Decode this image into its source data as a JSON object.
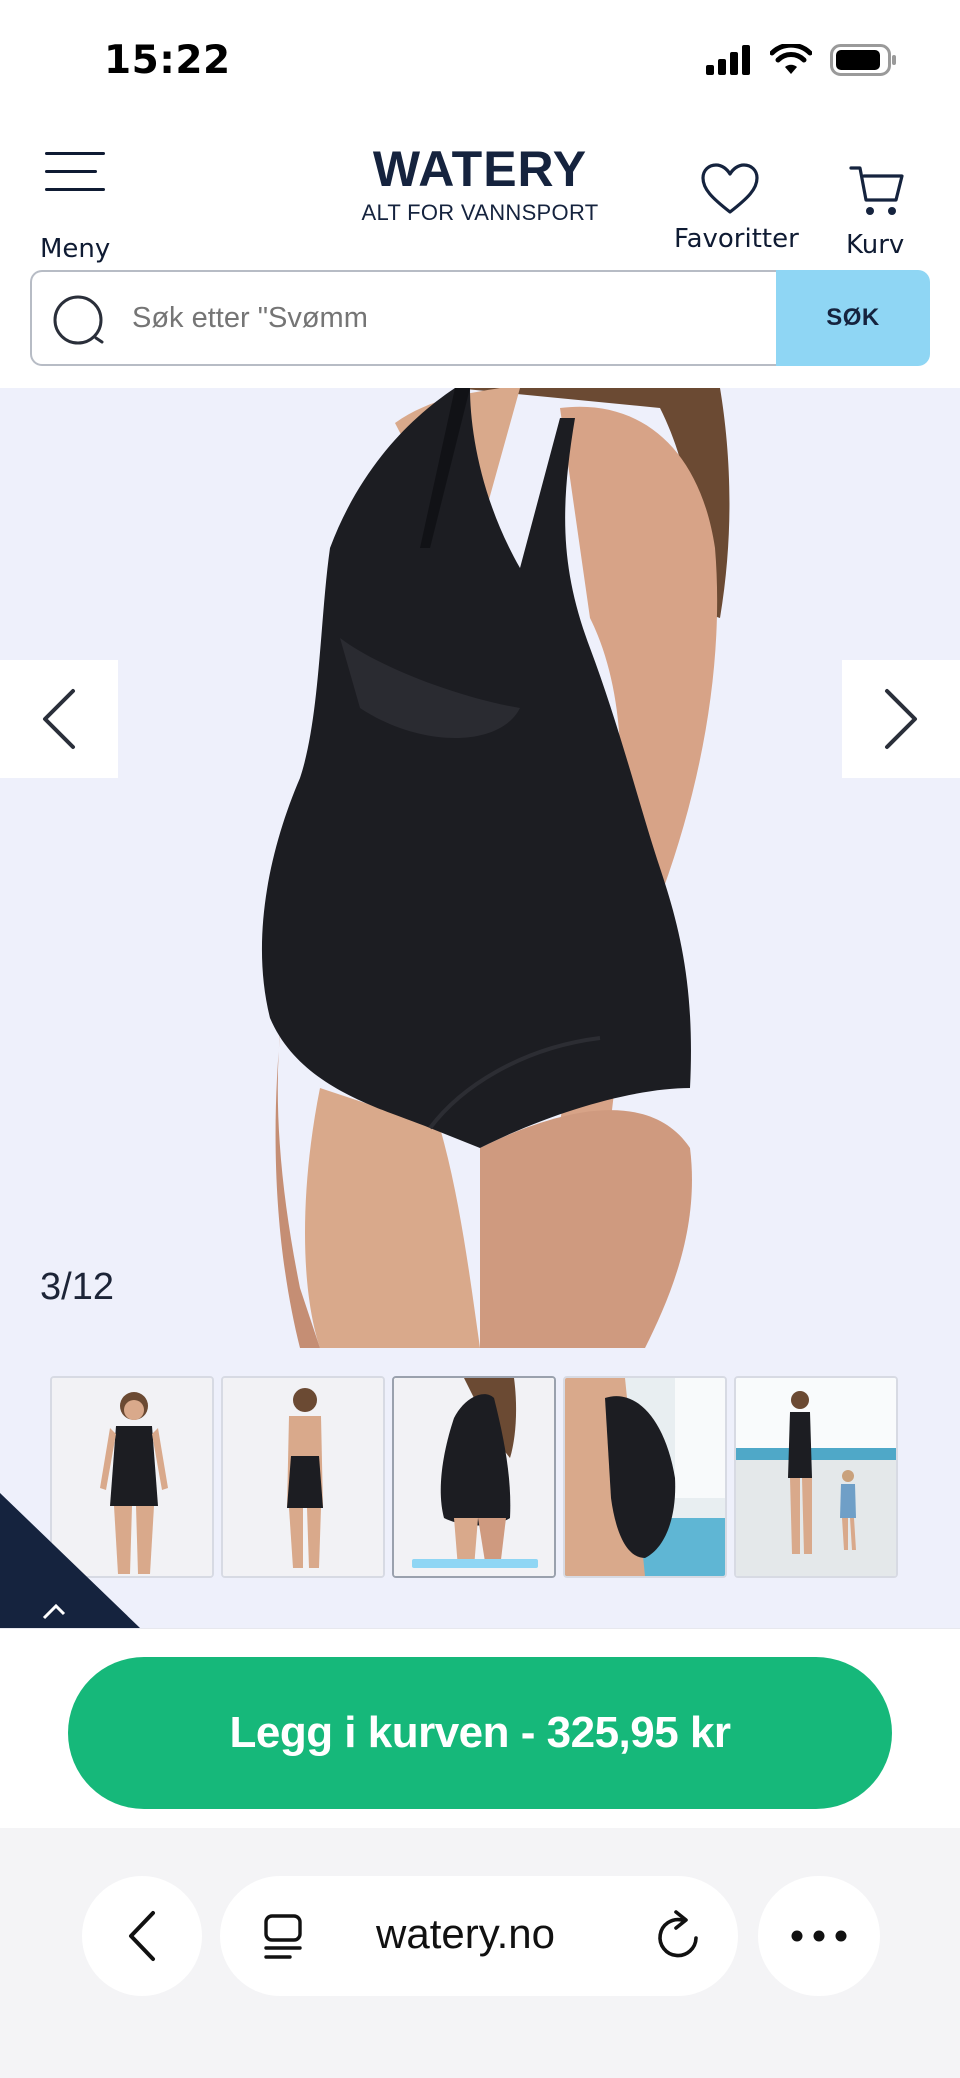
{
  "status_bar": {
    "time": "15:22"
  },
  "header": {
    "menu_label": "Meny",
    "logo_main": "WATERY",
    "logo_sub": "ALT FOR VANNSPORT",
    "favorites_label": "Favoritter",
    "cart_label": "Kurv"
  },
  "search": {
    "placeholder": "Søk etter \"Svømm",
    "button_label": "SØK"
  },
  "gallery": {
    "counter": "3/12",
    "current_index": 3,
    "total": 12,
    "thumbnails": [
      {
        "name": "front-view"
      },
      {
        "name": "back-view"
      },
      {
        "name": "side-view",
        "active": true
      },
      {
        "name": "pool-closeup"
      },
      {
        "name": "pool-with-child"
      }
    ]
  },
  "cart": {
    "add_button": "Legg i kurven - 325,95 kr"
  },
  "browser": {
    "url": "watery.no"
  },
  "colors": {
    "brand_navy": "#15233e",
    "accent_blue": "#8fd6f4",
    "cta_green": "#16b87a",
    "gallery_bg": "#eef0fb"
  }
}
